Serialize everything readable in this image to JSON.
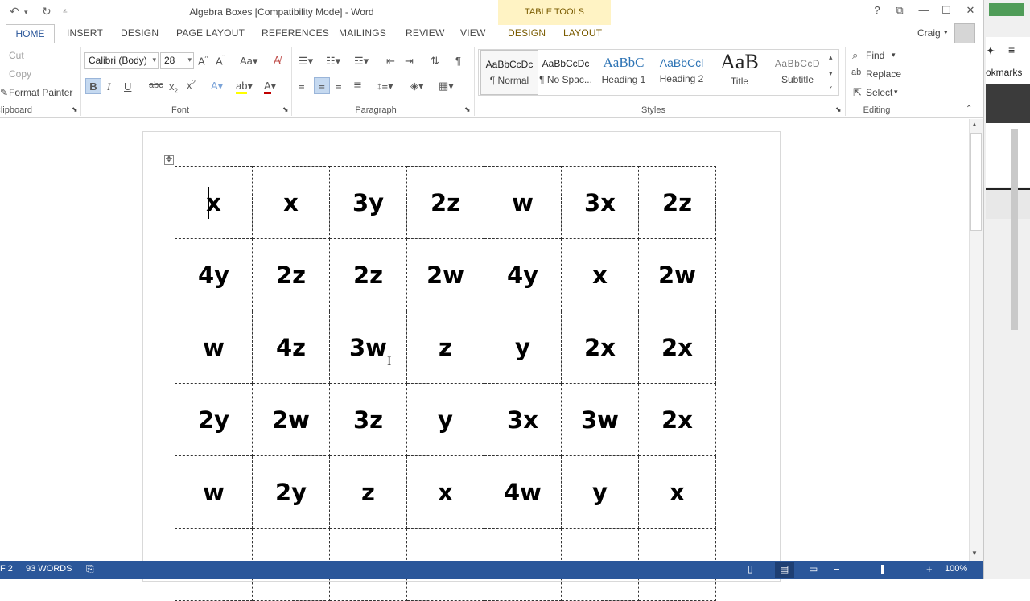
{
  "window": {
    "title": "Algebra Boxes [Compatibility Mode] - Word",
    "contextual_group": "TABLE TOOLS",
    "user": "Craig"
  },
  "tabs": {
    "home": "HOME",
    "insert": "INSERT",
    "design": "DESIGN",
    "page_layout": "PAGE LAYOUT",
    "references": "REFERENCES",
    "mailings": "MAILINGS",
    "review": "REVIEW",
    "view": "VIEW",
    "table_design": "DESIGN",
    "table_layout": "LAYOUT"
  },
  "clipboard": {
    "cut": "Cut",
    "copy": "Copy",
    "format_painter": "Format Painter",
    "label": "Clipboard"
  },
  "font": {
    "family": "Calibri (Body)",
    "size": "28",
    "label": "Font"
  },
  "paragraph": {
    "label": "Paragraph"
  },
  "styles": {
    "label": "Styles",
    "items": [
      {
        "sample": "AaBbCcDc",
        "name": "¶ Normal"
      },
      {
        "sample": "AaBbCcDc",
        "name": "¶ No Spac..."
      },
      {
        "sample": "AaBbC",
        "name": "Heading 1"
      },
      {
        "sample": "AaBbCcl",
        "name": "Heading 2"
      },
      {
        "sample": "AaB",
        "name": "Title"
      },
      {
        "sample": "AaBbCcD",
        "name": "Subtitle"
      }
    ]
  },
  "editing": {
    "label": "Editing",
    "find": "Find",
    "replace": "Replace",
    "select": "Select"
  },
  "side_panel": {
    "bookmarks": "okmarks"
  },
  "table": {
    "rows": [
      [
        "x",
        "x",
        "3y",
        "2z",
        "w",
        "3x",
        "2z"
      ],
      [
        "4y",
        "2z",
        "2z",
        "2w",
        "4y",
        "x",
        "2w"
      ],
      [
        "w",
        "4z",
        "3w",
        "z",
        "y",
        "2x",
        "2x"
      ],
      [
        "2y",
        "2w",
        "3z",
        "y",
        "3x",
        "3w",
        "2x"
      ],
      [
        "w",
        "2y",
        "z",
        "x",
        "4w",
        "y",
        "x"
      ]
    ]
  },
  "status": {
    "page": "F 2",
    "words": "93 WORDS",
    "zoom": "100%"
  },
  "colors": {
    "accent": "#2b579a",
    "contextual_band": "#fff3c4"
  }
}
